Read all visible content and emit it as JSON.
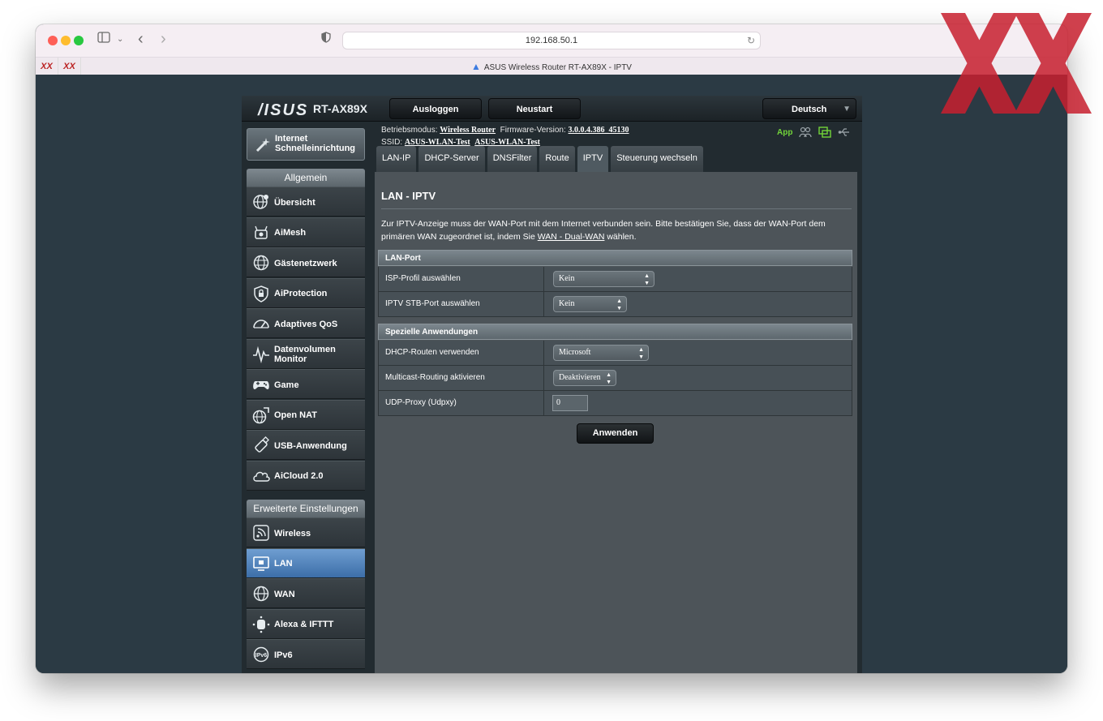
{
  "browser": {
    "url": "192.168.50.1",
    "tab_title": "ASUS Wireless Router RT-AX89X - IPTV",
    "pinned_tabs": [
      "XX",
      "XX"
    ]
  },
  "router": {
    "brand": "/ISUS",
    "model": "RT-AX89X",
    "logout_label": "Ausloggen",
    "restart_label": "Neustart",
    "language": "Deutsch"
  },
  "status": {
    "mode_label": "Betriebsmodus:",
    "mode_value": "Wireless Router",
    "firmware_label": "Firmware-Version:",
    "firmware_value": "3.0.0.4.386_45130",
    "ssid_label": "SSID:",
    "ssid_1": "ASUS-WLAN-Test",
    "ssid_2": "ASUS-WLAN-Test",
    "app_label": "App"
  },
  "sidebar": {
    "qis_label": "Internet Schnelleinrichtung",
    "general_header": "Allgemein",
    "general_items": [
      {
        "label": "Übersicht",
        "icon": "globe-gear-icon"
      },
      {
        "label": "AiMesh",
        "icon": "aimesh-router-icon"
      },
      {
        "label": "Gästenetzwerk",
        "icon": "guest-globe-icon"
      },
      {
        "label": "AiProtection",
        "icon": "shield-lock-icon"
      },
      {
        "label": "Adaptives QoS",
        "icon": "gauge-icon"
      },
      {
        "label": "Datenvolumen Monitor",
        "icon": "traffic-monitor-icon"
      },
      {
        "label": "Game",
        "icon": "gamepad-icon"
      },
      {
        "label": "Open NAT",
        "icon": "open-nat-globe-icon"
      },
      {
        "label": "USB-Anwendung",
        "icon": "usb-icon"
      },
      {
        "label": "AiCloud 2.0",
        "icon": "cloud-icon"
      }
    ],
    "advanced_header": "Erweiterte Einstellungen",
    "advanced_items": [
      {
        "label": "Wireless",
        "icon": "wifi-icon"
      },
      {
        "label": "LAN",
        "icon": "lan-monitor-icon",
        "active": true
      },
      {
        "label": "WAN",
        "icon": "wan-globe-icon"
      },
      {
        "label": "Alexa & IFTTT",
        "icon": "alexa-icon"
      },
      {
        "label": "IPv6",
        "icon": "ipv6-globe-icon"
      }
    ]
  },
  "tabs": [
    "LAN-IP",
    "DHCP-Server",
    "DNSFilter",
    "Route",
    "IPTV",
    "Steuerung wechseln"
  ],
  "active_tab": "IPTV",
  "content": {
    "title": "LAN - IPTV",
    "description_before": "Zur IPTV-Anzeige muss der WAN-Port mit dem Internet verbunden sein. Bitte bestätigen Sie, dass der WAN-Port dem primären WAN zugeordnet ist, indem Sie ",
    "description_link": "WAN - Dual-WAN",
    "description_after": " wählen.",
    "section1_header": "LAN-Port",
    "isp_label": "ISP-Profil auswählen",
    "isp_value": "Kein",
    "stb_label": "IPTV STB-Port auswählen",
    "stb_value": "Kein",
    "section2_header": "Spezielle Anwendungen",
    "dhcp_label": "DHCP-Routen verwenden",
    "dhcp_value": "Microsoft",
    "multicast_label": "Multicast-Routing aktivieren",
    "multicast_value": "Deaktivieren",
    "udp_label": "UDP-Proxy (Udpxy)",
    "udp_value": "0",
    "apply_label": "Anwenden"
  },
  "colors": {
    "active_menu": "#3c6ea8",
    "app_green": "#72d43a",
    "watermark_red": "#c8202f"
  }
}
